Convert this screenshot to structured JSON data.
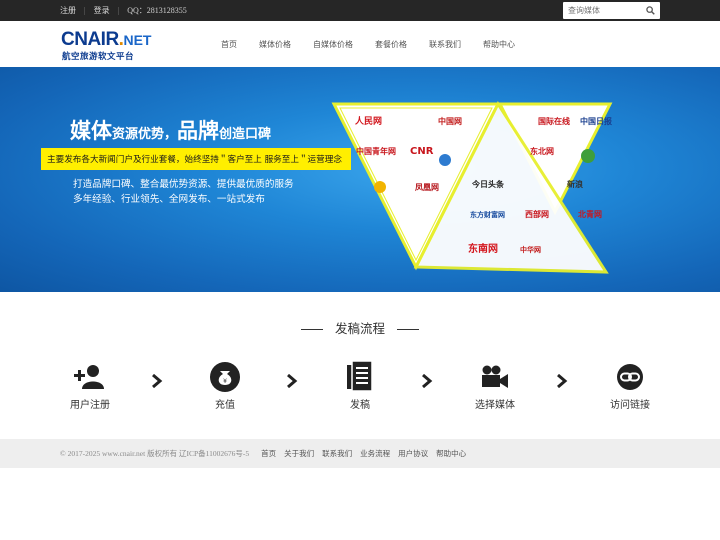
{
  "topbar": {
    "register": "注册",
    "login": "登录",
    "qq": "QQ：2813128355",
    "search_placeholder": "查询媒体"
  },
  "logo": {
    "main": "CNAIR",
    "dot": ".",
    "net": "NET",
    "sub": "航空旅游软文平台"
  },
  "nav": [
    {
      "label": "首页"
    },
    {
      "label": "媒体价格"
    },
    {
      "label": "自媒体价格"
    },
    {
      "label": "套餐价格"
    },
    {
      "label": "联系我们"
    },
    {
      "label": "帮助中心"
    }
  ],
  "banner": {
    "headline_1": "媒体",
    "headline_2": "资源优势，",
    "headline_3": "品牌",
    "headline_4": "创造口碑",
    "yellow_text": "主要发布各大新闻门户及行业套餐，始终坚持＂客户至上  服务至上＂运营理念",
    "line_1": "打造品牌口碑、整合最优势资源、提供最优质的服务",
    "line_2": "多年经验、行业领先、全网发布、一站式发布",
    "media_logos": [
      "人民网",
      "中国网",
      "CNR",
      "凤凰网",
      "今日头条",
      "东方财富网",
      "东南网",
      "中华网",
      "国际在线",
      "中国日报",
      "新浪",
      "北青网",
      "西部网",
      "东北网",
      "中国青年网"
    ]
  },
  "process": {
    "title": "发稿流程",
    "steps": [
      {
        "label": "用户注册",
        "icon": "user-add-icon"
      },
      {
        "label": "充值",
        "icon": "money-bag-icon"
      },
      {
        "label": "发稿",
        "icon": "document-icon"
      },
      {
        "label": "选择媒体",
        "icon": "video-camera-icon"
      },
      {
        "label": "访问链接",
        "icon": "link-icon"
      }
    ]
  },
  "footer": {
    "copyright": "© 2017-2025  www.cnair.net  版权所有  辽ICP备11002676号-5",
    "links": [
      {
        "label": "首页"
      },
      {
        "label": "关于我们"
      },
      {
        "label": "联系我们"
      },
      {
        "label": "业务流程"
      },
      {
        "label": "用户协议"
      },
      {
        "label": "帮助中心"
      }
    ]
  },
  "colors": {
    "topbar": "#262626",
    "brand_blue": "#0c3b8f",
    "banner_blue": "#1f86d6",
    "highlight_yellow": "#ffef00",
    "footer_bg": "#eeeeee"
  }
}
